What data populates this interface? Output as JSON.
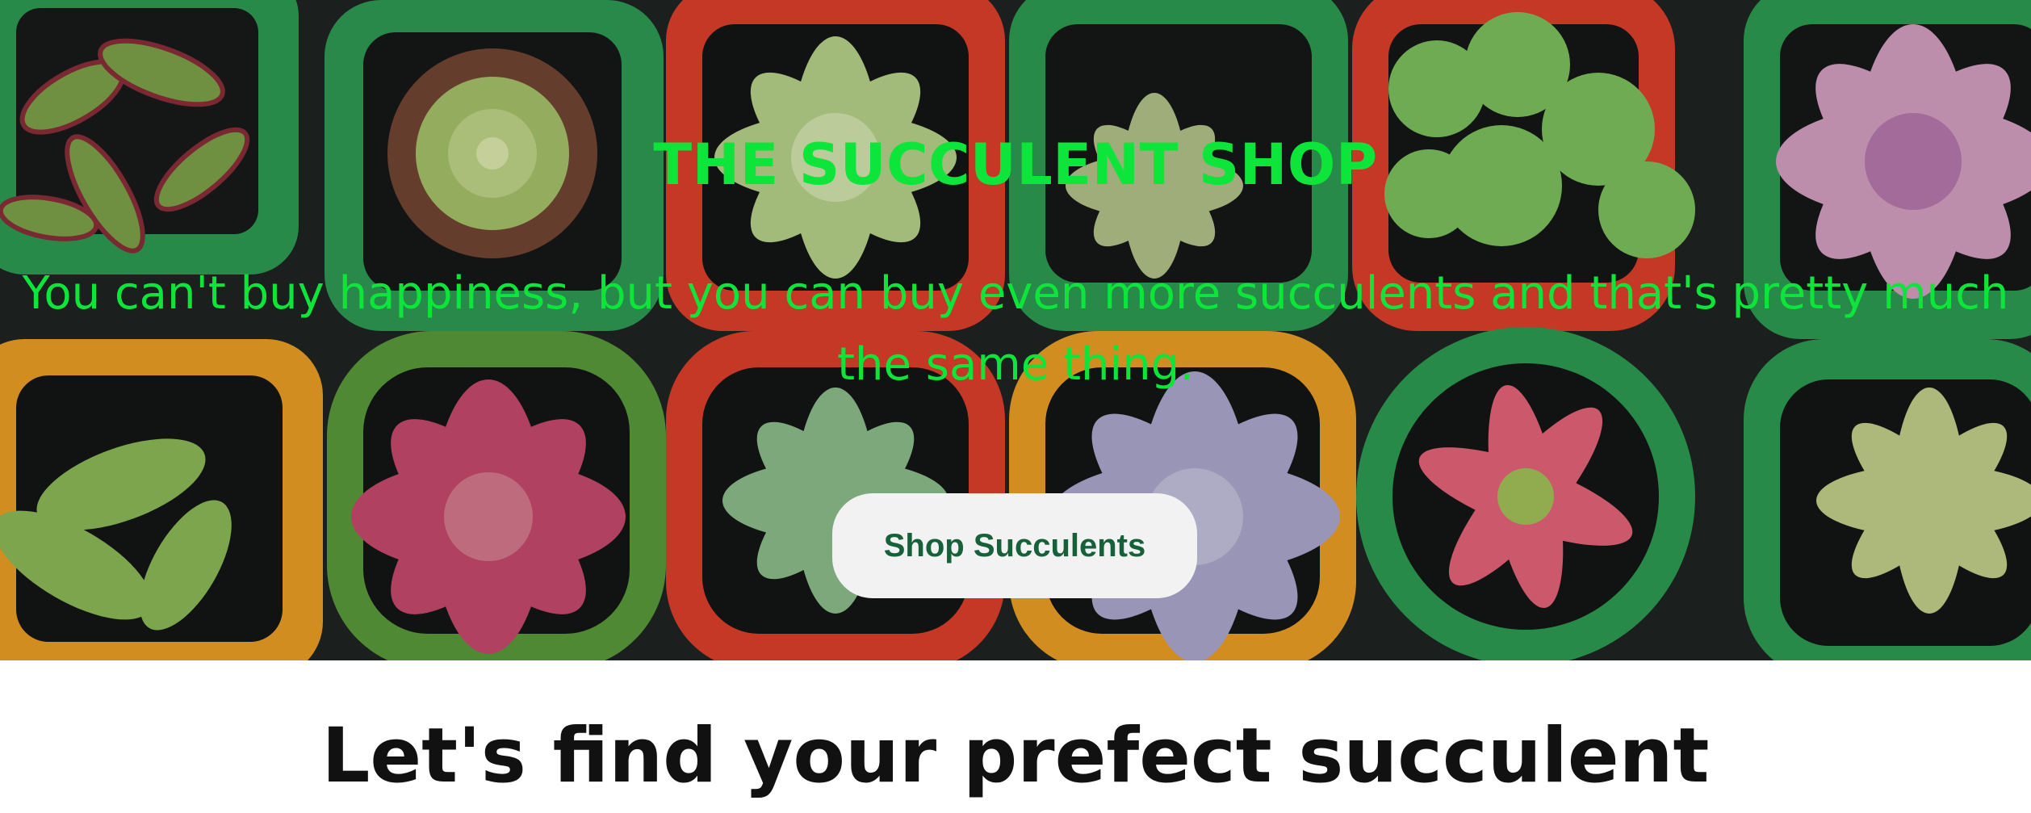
{
  "hero": {
    "title": "THE SUCCULENT SHOP",
    "tagline": "You can't buy happiness, but you can buy even more succulents and that's pretty much the same thing.",
    "cta_label": "Shop Succulents"
  },
  "section": {
    "heading": "Let's find your prefect succulent"
  },
  "colors": {
    "title_green": "#0ee53a",
    "button_text": "#17613a",
    "button_bg": "#f2f2f2",
    "heading_text": "#111111",
    "pot_colors": [
      "#2e9e52",
      "#e1402c",
      "#f0a126"
    ]
  },
  "images": {
    "hero_background": "succulents-in-colorful-pots-photo"
  }
}
